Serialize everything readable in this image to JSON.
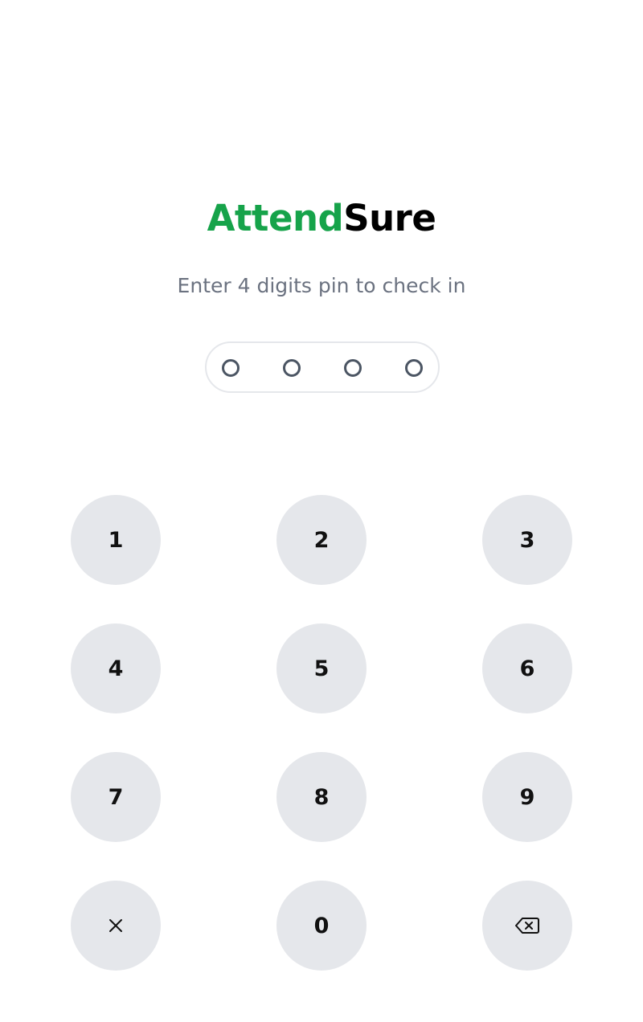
{
  "brand": {
    "name_part1": "Attend",
    "name_part2": "Sure",
    "accent_color": "#16a34a"
  },
  "subtitle": "Enter 4 digits pin to check in",
  "pin": {
    "length": 4,
    "entered": 0
  },
  "keypad": {
    "keys": [
      "1",
      "2",
      "3",
      "4",
      "5",
      "6",
      "7",
      "8",
      "9",
      "0"
    ],
    "clear_icon": "close-icon",
    "backspace_icon": "backspace-icon"
  }
}
